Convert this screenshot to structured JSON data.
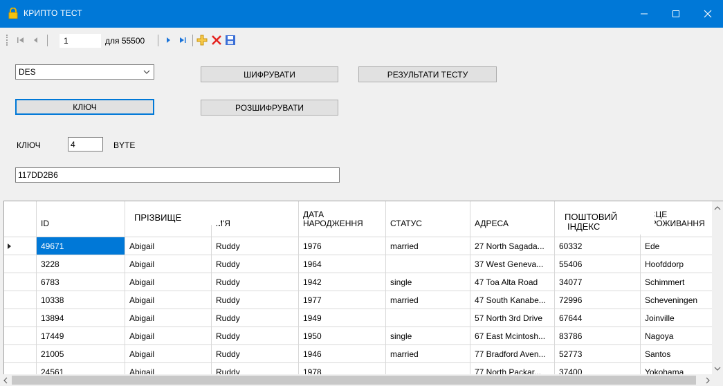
{
  "window": {
    "title": "КРИПТО ТЕСТ",
    "icons": [
      "lock-icon",
      "minimize-icon",
      "maximize-icon",
      "close-icon"
    ]
  },
  "navigator": {
    "position": "1",
    "count_label": "для 55500",
    "icons": [
      "move-first-icon",
      "move-previous-icon",
      "move-next-icon",
      "move-last-icon",
      "add-new-icon",
      "delete-icon",
      "save-icon"
    ]
  },
  "form": {
    "algorithm": "DES",
    "encrypt_label": "ШИФРУВАТИ",
    "results_label": "РЕЗУЛЬТАТИ ТЕСТУ",
    "key_button_label": "КЛЮЧ",
    "decrypt_label": "РОЗШИФРУВАТИ",
    "key_label": "КЛЮЧ",
    "key_size": "4",
    "key_unit": "BYTE",
    "key_value": "117DD2B6"
  },
  "grid": {
    "headers": [
      "ID",
      "ПРІЗВИЩЕ",
      "М'Я",
      "ДАТА НАРОДЖЕННЯ",
      "СТАТУС",
      "АДРЕСА",
      "ПОШТОВИЙ ІНДЕКС",
      "ІІСЦЕ ПРОЖИВАННЯ"
    ],
    "header_lines": {
      "birth": [
        "ДАТА",
        "НАРОДЖЕННЯ"
      ],
      "postal": [
        "ПОШТОВИЙ",
        "ІНДЕКС"
      ],
      "place": [
        "ІІСЦЕ",
        "ПРОЖИВАННЯ"
      ]
    },
    "rows": [
      [
        "49671",
        "Abigail",
        "Ruddy",
        "1976",
        "married",
        "27 North Sagada...",
        "60332",
        "Ede"
      ],
      [
        "3228",
        "Abigail",
        "Ruddy",
        "1964",
        "",
        "37 West Geneva...",
        "55406",
        "Hoofddorp"
      ],
      [
        "6783",
        "Abigail",
        "Ruddy",
        "1942",
        "single",
        "47 Toa Alta Road",
        "34077",
        "Schimmert"
      ],
      [
        "10338",
        "Abigail",
        "Ruddy",
        "1977",
        "married",
        "47 South Kanabe...",
        "72996",
        "Scheveningen"
      ],
      [
        "13894",
        "Abigail",
        "Ruddy",
        "1949",
        "",
        "57 North 3rd Drive",
        "67644",
        "Joinville"
      ],
      [
        "17449",
        "Abigail",
        "Ruddy",
        "1950",
        "single",
        "67 East Mcintosh...",
        "83786",
        "Nagoya"
      ],
      [
        "21005",
        "Abigail",
        "Ruddy",
        "1946",
        "married",
        "77 Bradford Aven...",
        "52773",
        "Santos"
      ],
      [
        "24561",
        "Abigail",
        "Ruddy",
        "1978",
        "",
        "77 North Packar...",
        "37400",
        "Yokohama"
      ]
    ],
    "current_row_icon": "current-row-arrow-icon"
  },
  "colors": {
    "titlebar": "#0078d7",
    "selection": "#0078d7",
    "window_bg": "#f0f0f0"
  }
}
